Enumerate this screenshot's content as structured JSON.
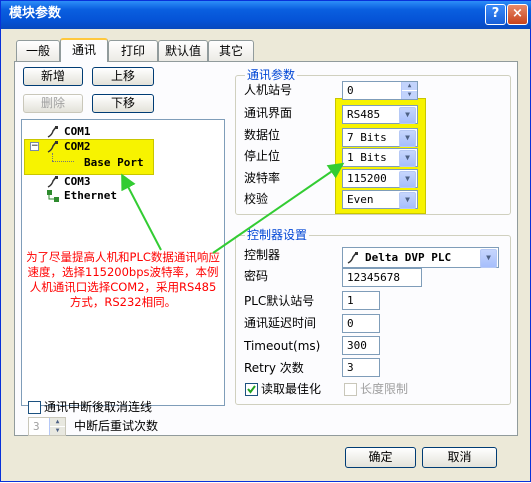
{
  "window": {
    "title": "模块参数",
    "help_label": "?",
    "close_label": "×"
  },
  "tabs": [
    {
      "label": "一般"
    },
    {
      "label": "通讯"
    },
    {
      "label": "打印"
    },
    {
      "label": "默认值"
    },
    {
      "label": "其它"
    }
  ],
  "toolbar": {
    "add": "新增",
    "up": "上移",
    "delete": "删除",
    "down": "下移"
  },
  "tree": {
    "items": [
      {
        "label": "COM1"
      },
      {
        "label": "COM2",
        "toggle": "−",
        "child": "Base Port"
      },
      {
        "label": "COM3"
      },
      {
        "label": "Ethernet"
      }
    ]
  },
  "annotation": "为了尽量提高人机和PLC数据通讯响应速度，选择115200bps波特率，本例人机通讯口选择COM2，采用RS485方式，RS232相同。",
  "comm": {
    "group_title": "通讯参数",
    "hmi_station_label": "人机站号",
    "hmi_station_value": "0",
    "interface_label": "通讯界面",
    "interface_value": "RS485",
    "databits_label": "数据位",
    "databits_value": "7 Bits",
    "stopbits_label": "停止位",
    "stopbits_value": "1 Bits",
    "baud_label": "波特率",
    "baud_value": "115200",
    "parity_label": "校验",
    "parity_value": "Even"
  },
  "controller": {
    "group_title": "控制器设置",
    "controller_label": "控制器",
    "controller_value": "Delta DVP PLC",
    "password_label": "密码",
    "password_value": "12345678",
    "plc_station_label": "PLC默认站号",
    "plc_station_value": "1",
    "delay_label": "通讯延迟时间",
    "delay_value": "0",
    "timeout_label": "Timeout(ms)",
    "timeout_value": "300",
    "retry_label": "Retry 次数",
    "retry_value": "3",
    "optimize_label": "读取最佳化",
    "optimize_checked": true,
    "length_limit_label": "长度限制",
    "length_limit_checked": false
  },
  "bottom": {
    "cancel_on_interrupt_label": "通讯中断後取消连线",
    "retry_after_label": "中断后重试次数",
    "retry_after_value": "3"
  },
  "footer": {
    "ok": "确定",
    "cancel": "取消"
  },
  "colors": {
    "titlebar": "#0553d6",
    "highlight": "#f7f300",
    "annotation_text": "#ff0000",
    "arrow": "#33cc33",
    "group_title": "#0046d5"
  }
}
